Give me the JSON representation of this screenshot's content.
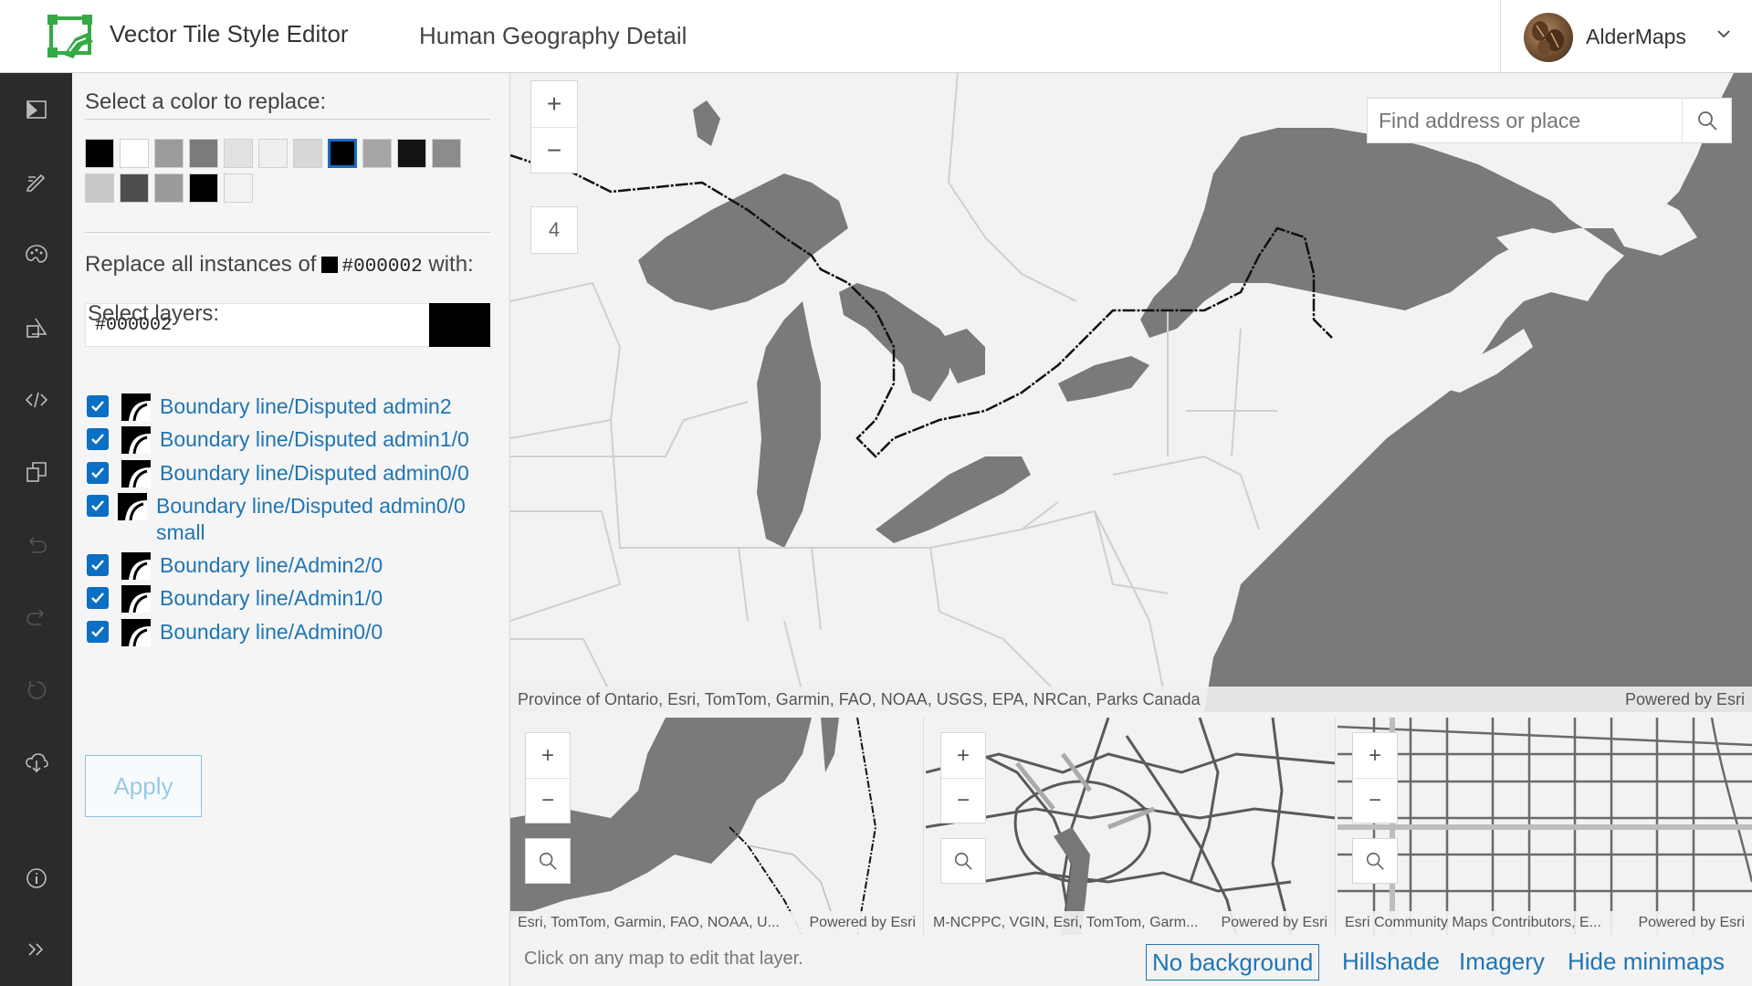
{
  "header": {
    "app_title": "Vector Tile Style Editor",
    "style_title": "Human Geography Detail",
    "user_name": "AlderMaps"
  },
  "rail": {
    "icons": [
      "map-icon",
      "edit-icon",
      "palette-icon",
      "shapes-icon",
      "code-icon",
      "copy-icon",
      "undo-icon",
      "redo-icon",
      "reset-icon",
      "download-cloud-icon",
      "info-icon",
      "expand-icon"
    ]
  },
  "panel": {
    "select_color_heading": "Select a color to replace:",
    "swatches": [
      "#000000",
      "#ffffff",
      "#9c9c9c",
      "#7b7b7b",
      "#e1e1e1",
      "#efefef",
      "#d7d7d7",
      "#000002",
      "#a6a6a6",
      "#141414",
      "#8c8c8c",
      "#c8c8c8",
      "#4e4e4e",
      "#9a9a9a",
      "#000000",
      "#f2f2f2"
    ],
    "selected_swatch": "#000002",
    "replace_prefix": "Replace all instances of",
    "replace_hex": "#000002",
    "replace_suffix": "with:",
    "hex_input_value": "#000002",
    "replacement_color": "#000000",
    "select_layers_heading": "Select layers:",
    "layers": [
      {
        "label": "Boundary line/Disputed admin2",
        "checked": true
      },
      {
        "label": "Boundary line/Disputed admin1/0",
        "checked": true
      },
      {
        "label": "Boundary line/Disputed admin0/0",
        "checked": true
      },
      {
        "label": "Boundary line/Disputed admin0/0",
        "label2": "small",
        "checked": true
      },
      {
        "label": "Boundary line/Admin2/0",
        "checked": true
      },
      {
        "label": "Boundary line/Admin1/0",
        "checked": true
      },
      {
        "label": "Boundary line/Admin0/0",
        "checked": true
      }
    ],
    "apply_label": "Apply"
  },
  "main_map": {
    "zoom_in": "+",
    "zoom_out": "−",
    "zoom_level": "4",
    "search_placeholder": "Find address or place",
    "attribution": "Province of Ontario, Esri, TomTom, Garmin, FAO, NOAA, USGS, EPA, NRCan, Parks Canada",
    "powered_by": "Powered by Esri"
  },
  "minimaps": [
    {
      "zoom_in": "+",
      "zoom_out": "−",
      "attribution": "Esri, TomTom, Garmin, FAO, NOAA, U...",
      "powered_by": "Powered by Esri"
    },
    {
      "zoom_in": "+",
      "zoom_out": "−",
      "attribution": "M-NCPPC, VGIN, Esri, TomTom, Garm...",
      "powered_by": "Powered by Esri"
    },
    {
      "zoom_in": "+",
      "zoom_out": "−",
      "attribution": "Esri Community Maps Contributors, E...",
      "powered_by": "Powered by Esri"
    }
  ],
  "footer": {
    "hint": "Click on any map to edit that layer.",
    "options": [
      "No background",
      "Hillshade",
      "Imagery",
      "Hide minimaps"
    ],
    "active_option": "No background"
  },
  "colors": {
    "accent": "#1f75b3",
    "checkbox": "#0b6fc4",
    "rail": "#2b2b2b",
    "water": "#7a7a7a",
    "land": "#f2f2f2",
    "logo_green": "#35a945"
  }
}
